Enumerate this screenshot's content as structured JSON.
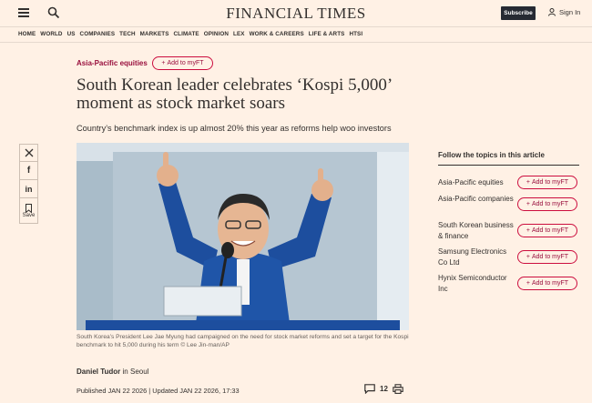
{
  "header": {
    "logo": "FINANCIAL TIMES",
    "subscribe_label": "Subscribe",
    "signin_label": "Sign In"
  },
  "nav": {
    "items": [
      "HOME",
      "WORLD",
      "US",
      "COMPANIES",
      "TECH",
      "MARKETS",
      "CLIMATE",
      "OPINION",
      "LEX",
      "WORK & CAREERS",
      "LIFE & ARTS",
      "HTSI"
    ]
  },
  "article": {
    "topic": "Asia-Pacific equities",
    "add_myft_label": "Add to myFT",
    "headline": "South Korean leader celebrates ‘Kospi 5,000’ moment as stock market soars",
    "standfirst": "Country’s benchmark index is up almost 20% this year as reforms help woo investors",
    "caption": "South Korea’s President Lee Jae Myung had campaigned on the need for stock market reforms and set a target for the Kospi benchmark to hit 5,000 during his term © Lee Jin-man/AP",
    "author": "Daniel Tudor",
    "location": "in Seoul",
    "published": "Published JAN 22 2026 | Updated JAN 22 2026, 17:33",
    "comment_count": "12"
  },
  "share": {
    "x_icon": "x-icon",
    "facebook_icon": "f",
    "linkedin_icon": "in",
    "save_label": "Save"
  },
  "sidebar": {
    "title": "Follow the topics in this article",
    "topics": [
      {
        "name": "Asia-Pacific equities",
        "button": "Add to myFT"
      },
      {
        "name": "Asia-Pacific companies",
        "button": "Add to myFT"
      },
      {
        "name": "South Korean business & finance",
        "button": "Add to myFT"
      },
      {
        "name": "Samsung Electronics Co Ltd",
        "button": "Add to myFT"
      },
      {
        "name": "Hynix Semiconductor Inc",
        "button": "Add to myFT"
      }
    ]
  },
  "colors": {
    "background": "#fff1e5",
    "accent": "#990f3d",
    "text": "#33302e",
    "subscribe_bg": "#262a33"
  }
}
